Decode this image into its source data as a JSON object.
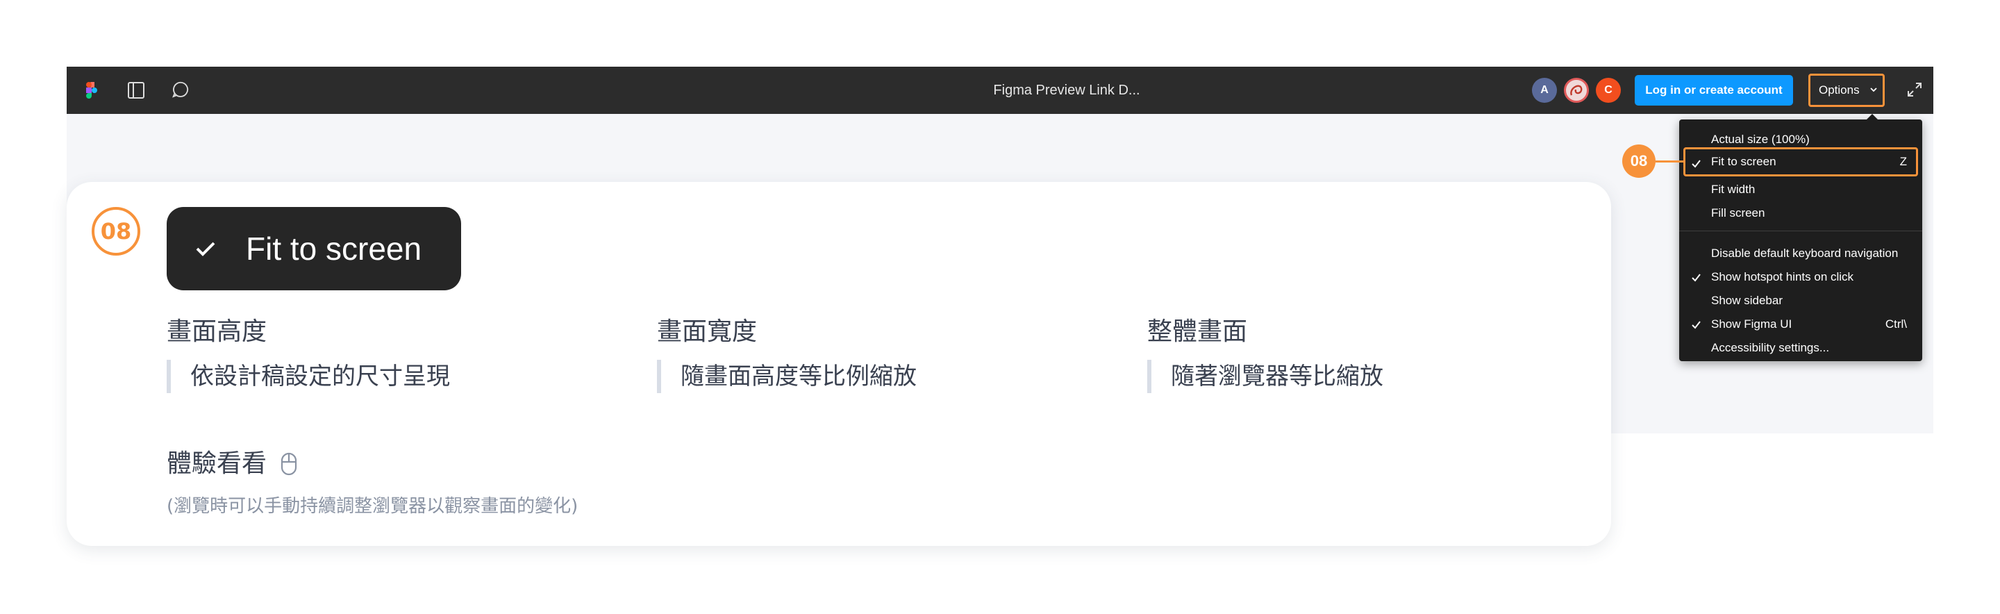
{
  "topbar": {
    "title": "Figma Preview Link D...",
    "avatars": [
      "A",
      "C"
    ],
    "login_label": "Log in or create account",
    "options_label": "Options"
  },
  "menu": {
    "items": [
      {
        "label": "Actual size (100%)",
        "checked": false,
        "shortcut": ""
      },
      {
        "label": "Fit to screen",
        "checked": true,
        "shortcut": "Z"
      },
      {
        "label": "Fit width",
        "checked": false,
        "shortcut": ""
      },
      {
        "label": "Fill screen",
        "checked": false,
        "shortcut": ""
      },
      {
        "label": "Disable default keyboard navigation",
        "checked": false,
        "shortcut": ""
      },
      {
        "label": "Show hotspot hints on click",
        "checked": true,
        "shortcut": ""
      },
      {
        "label": "Show sidebar",
        "checked": false,
        "shortcut": ""
      },
      {
        "label": "Show Figma UI",
        "checked": true,
        "shortcut": "Ctrl\\"
      },
      {
        "label": "Accessibility settings...",
        "checked": false,
        "shortcut": ""
      }
    ]
  },
  "annotation": {
    "badge": "08",
    "feature": "Fit to screen"
  },
  "card": {
    "columns": [
      {
        "title": "畫面高度",
        "desc": "依設計稿設定的尺寸呈現"
      },
      {
        "title": "畫面寬度",
        "desc": "隨畫面高度等比例縮放"
      },
      {
        "title": "整體畫面",
        "desc": "隨著瀏覽器等比縮放"
      }
    ],
    "try_title": "體驗看看",
    "try_hint": "(瀏覽時可以手動持續調整瀏覽器以觀察畫面的變化)"
  },
  "colors": {
    "accent": "#f7923a",
    "figma_blue": "#0d99ff",
    "toolbar": "#2c2c2c",
    "menu": "#1e1e1e"
  }
}
